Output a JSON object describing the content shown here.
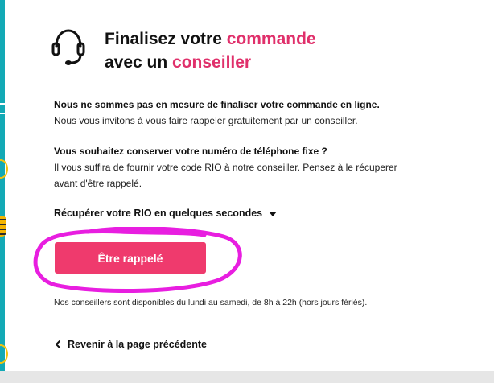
{
  "header": {
    "title_line1_prefix": "Finalisez votre ",
    "title_line1_accent": "commande",
    "title_line2_prefix": "avec un ",
    "title_line2_accent": "conseiller",
    "icon": "headset-icon"
  },
  "notice": {
    "heading": "Nous ne sommes pas en mesure de finaliser votre commande en ligne.",
    "text": "Nous vous invitons à vous faire rappeler gratuitement par un conseiller."
  },
  "phone_number": {
    "heading": "Vous souhaitez conserver votre numéro de téléphone fixe ?",
    "text_line1": "Il vous suffira de fournir votre code RIO à notre conseiller. Pensez à le récuperer",
    "text_line2": "avant d'être rappelé."
  },
  "rio_toggle": {
    "label": "Récupérer votre RIO en quelques secondes",
    "icon": "caret-down-icon"
  },
  "cta": {
    "label": "Être rappelé"
  },
  "availability": {
    "text": "Nos conseillers sont disponibles du lundi au samedi, de 8h à 22h (hors jours fériés)."
  },
  "back_link": {
    "label": "Revenir à la page précédente",
    "icon": "chevron-left-icon"
  },
  "colors": {
    "accent": "#e0306b",
    "button": "#ef3a6d",
    "annotation": "#e81ee0",
    "left_strip": "#13a9b5"
  }
}
